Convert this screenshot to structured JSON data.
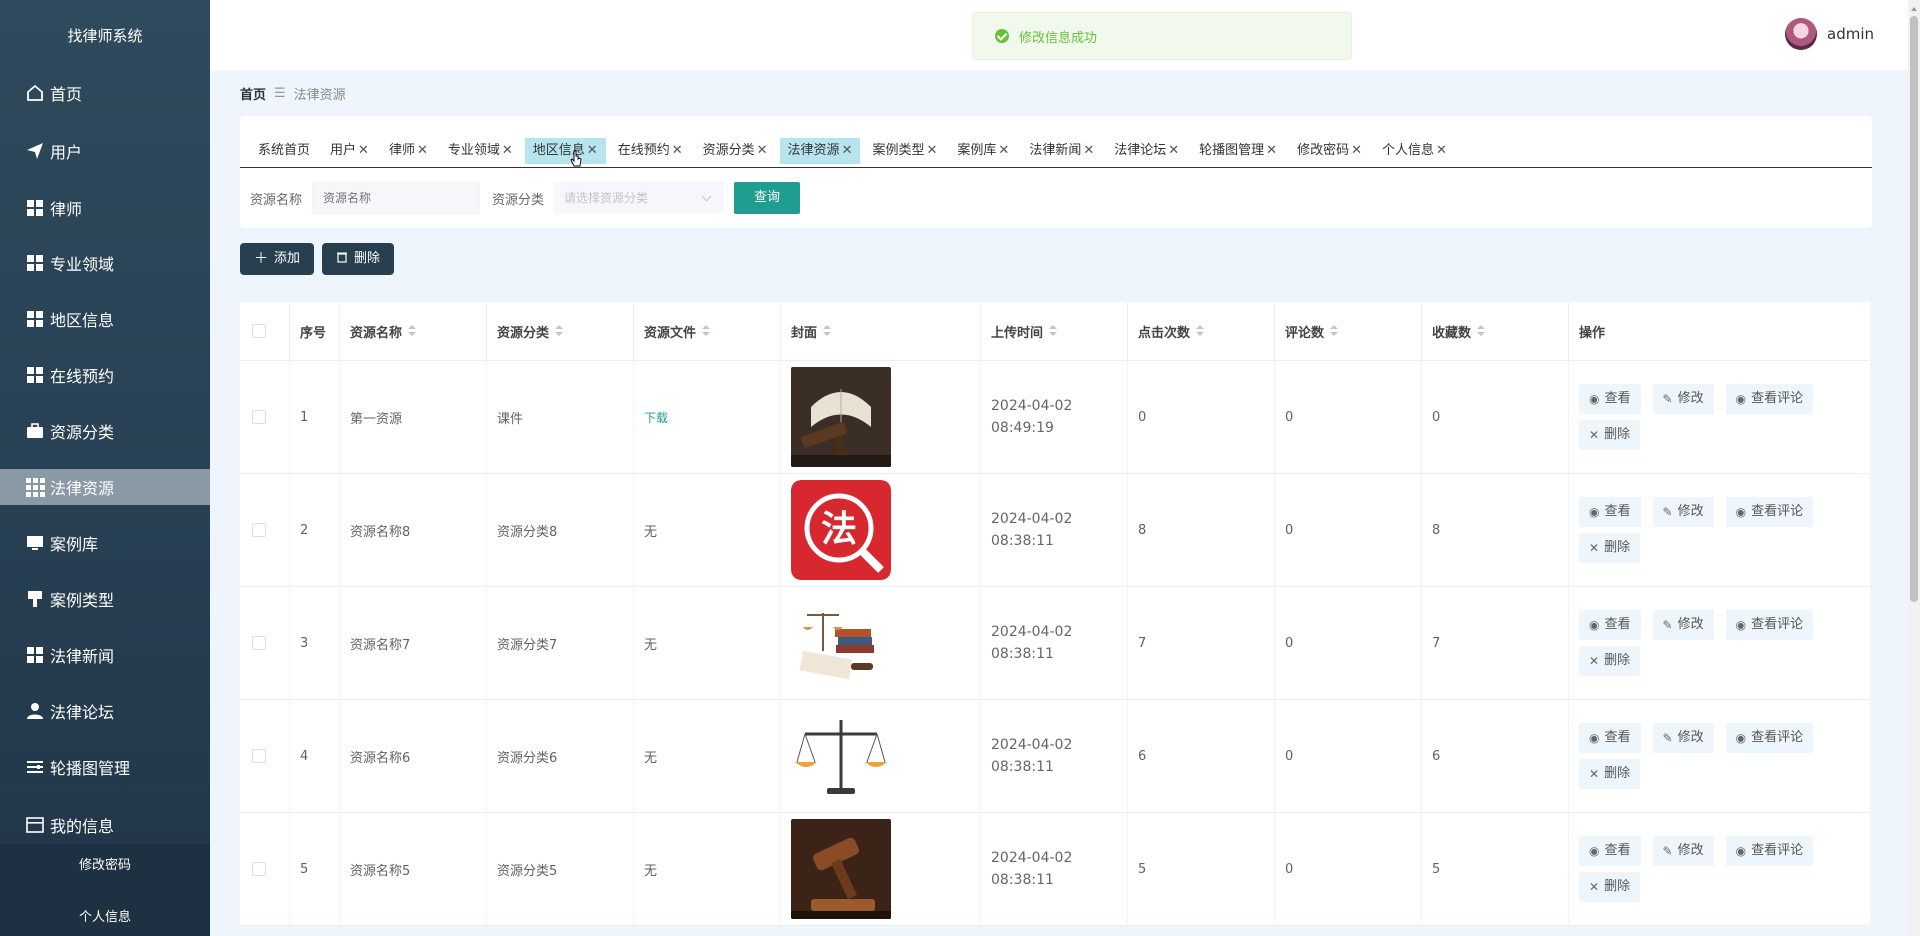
{
  "app_title": "找律师系统",
  "sidebar": {
    "items": [
      {
        "label": "首页",
        "icon": "home-icon"
      },
      {
        "label": "用户",
        "icon": "send-icon"
      },
      {
        "label": "律师",
        "icon": "grid-icon"
      },
      {
        "label": "专业领域",
        "icon": "grid-icon"
      },
      {
        "label": "地区信息",
        "icon": "grid-icon"
      },
      {
        "label": "在线预约",
        "icon": "grid-icon"
      },
      {
        "label": "资源分类",
        "icon": "briefcase-icon"
      },
      {
        "label": "法律资源",
        "icon": "apps-icon"
      },
      {
        "label": "案例库",
        "icon": "monitor-icon"
      },
      {
        "label": "案例类型",
        "icon": "brush-icon"
      },
      {
        "label": "法律新闻",
        "icon": "grid-icon"
      },
      {
        "label": "法律论坛",
        "icon": "user-icon"
      },
      {
        "label": "轮播图管理",
        "icon": "sliders-icon"
      },
      {
        "label": "我的信息",
        "icon": "card-icon"
      }
    ],
    "sub_items": [
      "修改密码",
      "个人信息"
    ]
  },
  "toast": {
    "text": "修改信息成功",
    "color": "#67c23a"
  },
  "user": {
    "name": "admin"
  },
  "breadcrumb": {
    "home": "首页",
    "current": "法律资源"
  },
  "tabs": [
    {
      "label": "系统首页",
      "closable": false
    },
    {
      "label": "用户",
      "closable": true
    },
    {
      "label": "律师",
      "closable": true
    },
    {
      "label": "专业领域",
      "closable": true
    },
    {
      "label": "地区信息",
      "closable": true
    },
    {
      "label": "在线预约",
      "closable": true
    },
    {
      "label": "资源分类",
      "closable": true
    },
    {
      "label": "法律资源",
      "closable": true
    },
    {
      "label": "案例类型",
      "closable": true
    },
    {
      "label": "案例库",
      "closable": true
    },
    {
      "label": "法律新闻",
      "closable": true
    },
    {
      "label": "法律论坛",
      "closable": true
    },
    {
      "label": "轮播图管理",
      "closable": true
    },
    {
      "label": "修改密码",
      "closable": true
    },
    {
      "label": "个人信息",
      "closable": true
    }
  ],
  "search": {
    "name_label": "资源名称",
    "name_placeholder": "资源名称",
    "category_label": "资源分类",
    "category_placeholder": "请选择资源分类",
    "query_button": "查询"
  },
  "toolbar": {
    "add_label": "添加",
    "delete_label": "删除"
  },
  "table": {
    "headers": [
      "序号",
      "资源名称",
      "资源分类",
      "资源文件",
      "封面",
      "上传时间",
      "点击次数",
      "评论数",
      "收藏数",
      "操作"
    ],
    "rows": [
      {
        "index": "1",
        "name": "第一资源",
        "category": "课件",
        "file": "下载",
        "time": "2024-04-02 08:49:19",
        "clicks": "0",
        "comments": "0",
        "favorites": "0",
        "cover": "book-gavel"
      },
      {
        "index": "2",
        "name": "资源名称8",
        "category": "资源分类8",
        "file": "无",
        "time": "2024-04-02 08:38:11",
        "clicks": "8",
        "comments": "0",
        "favorites": "8",
        "cover": "fa-logo"
      },
      {
        "index": "3",
        "name": "资源名称7",
        "category": "资源分类7",
        "file": "无",
        "time": "2024-04-02 08:38:11",
        "clicks": "7",
        "comments": "0",
        "favorites": "7",
        "cover": "scales-books"
      },
      {
        "index": "4",
        "name": "资源名称6",
        "category": "资源分类6",
        "file": "无",
        "time": "2024-04-02 08:38:11",
        "clicks": "6",
        "comments": "0",
        "favorites": "6",
        "cover": "scales"
      },
      {
        "index": "5",
        "name": "资源名称5",
        "category": "资源分类5",
        "file": "无",
        "time": "2024-04-02 08:38:11",
        "clicks": "5",
        "comments": "0",
        "favorites": "5",
        "cover": "gavel"
      }
    ],
    "ops": {
      "view": "查看",
      "edit": "修改",
      "view_comments": "查看评论",
      "delete": "删除"
    },
    "fa_text": "法"
  },
  "colors": {
    "accent": "#1f9e8f",
    "sidebar_active": "#8a99a6",
    "tab_active": "#b6e4ef",
    "dark_button": "#283f50"
  }
}
